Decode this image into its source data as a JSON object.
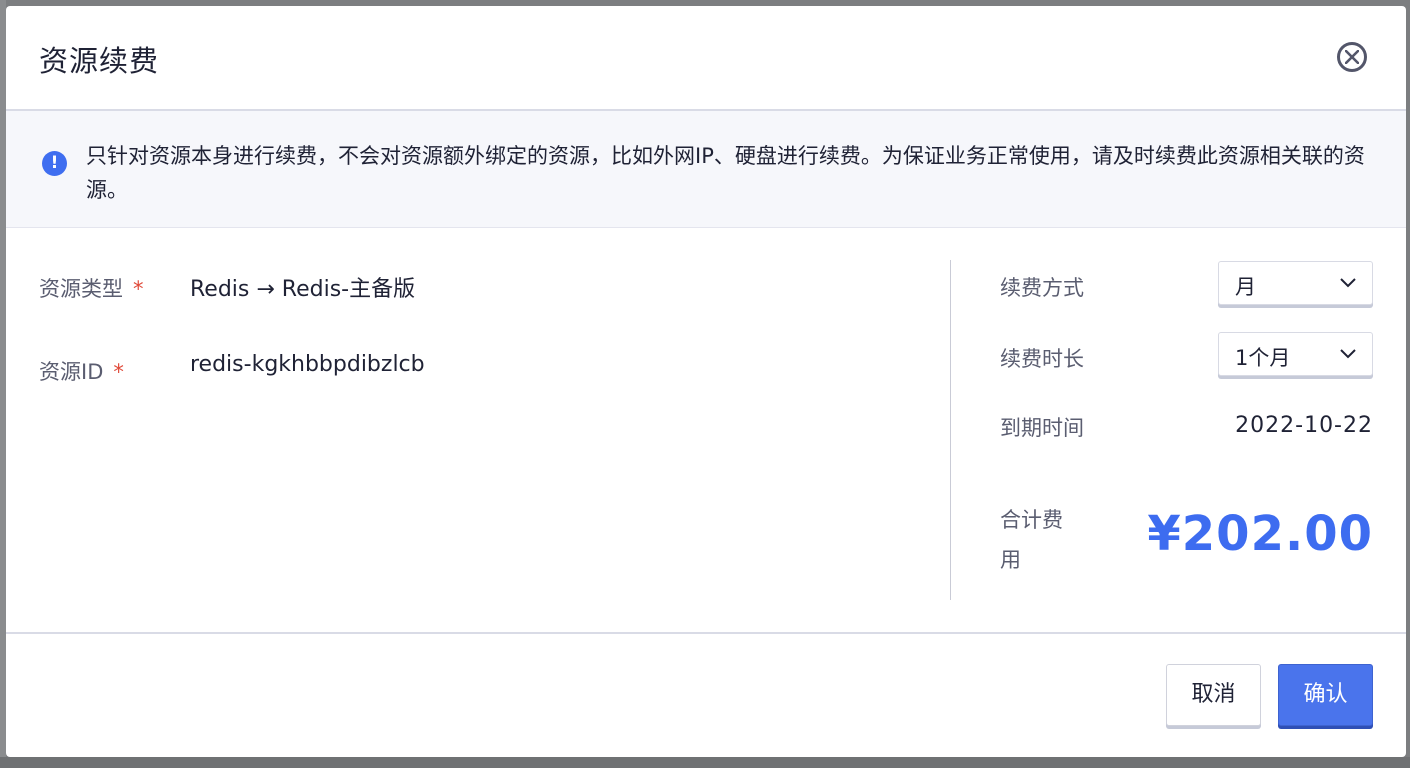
{
  "dialog": {
    "title": "资源续费"
  },
  "notice": {
    "text": "只针对资源本身进行续费，不会对资源额外绑定的资源，比如外网IP、硬盘进行续费。为保证业务正常使用，请及时续费此资源相关联的资源。",
    "icon": "info-icon"
  },
  "resource": {
    "type_label": "资源类型",
    "type_value": "Redis → Redis-主备版",
    "id_label": "资源ID",
    "id_value": "redis-kgkhbbpdibzlcb",
    "required_mark": "*"
  },
  "renewal": {
    "mode_label": "续费方式",
    "mode_value": "月",
    "duration_label": "续费时长",
    "duration_value": "1个月",
    "expire_label": "到期时间",
    "expire_value": "2022-10-22",
    "total_label": "合计费用",
    "total_value": "¥202.00"
  },
  "actions": {
    "cancel_label": "取消",
    "confirm_label": "确认"
  },
  "colors": {
    "accent": "#3d6cf0",
    "required": "#e04a3a",
    "overlay": "#7c7e80"
  }
}
